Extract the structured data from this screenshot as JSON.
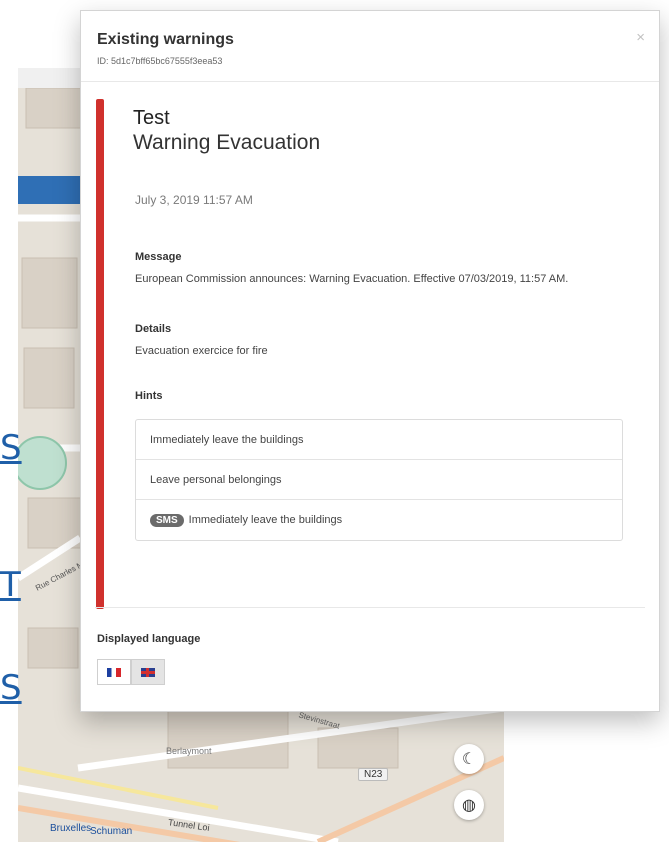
{
  "dialog": {
    "title": "Existing warnings",
    "id_text": "ID: 5d1c7bff65bc67555f3eea53",
    "close_glyph": "×"
  },
  "warning": {
    "prefix": "Test",
    "title": "Warning Evacuation",
    "date": "July 3, 2019 11:57 AM",
    "accent_color": "#d0312d",
    "message_label": "Message",
    "message": "European Commission announces: Warning Evacuation. Effective 07/03/2019, 11:57 AM.",
    "details_label": "Details",
    "details": "Evacuation exercice for fire",
    "hints_label": "Hints",
    "hints": [
      {
        "text": "Immediately leave the buildings",
        "badge": ""
      },
      {
        "text": "Leave personal belongings",
        "badge": ""
      },
      {
        "text": "Immediately leave the buildings",
        "badge": "SMS"
      }
    ]
  },
  "language": {
    "label": "Displayed language",
    "options": [
      {
        "code": "fr",
        "icon": "flag-fr-icon",
        "active": false
      },
      {
        "code": "en",
        "icon": "flag-uk-icon",
        "active": true
      }
    ]
  },
  "map": {
    "labels": {
      "berlaymont": "Berlaymont",
      "n23": "N23",
      "bruxelles": "Bruxelles",
      "schuman": "Schuman",
      "tunnel": "Tunnel Loi",
      "stevin": "Stevinstraat",
      "charles": "Rue Charles Martel"
    },
    "controls": [
      "moon-icon",
      "globe-icon"
    ]
  },
  "slide_glyphs": [
    "S",
    "T",
    "S"
  ]
}
